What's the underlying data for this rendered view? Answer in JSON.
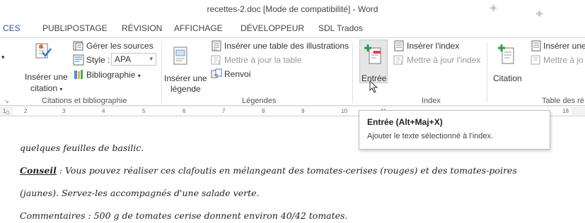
{
  "window": {
    "title": "recettes-2.doc [Mode de compatibilité] - Word"
  },
  "tabs": [
    {
      "label": "CES",
      "active": true
    },
    {
      "label": "PUBLIPOSTAGE"
    },
    {
      "label": "RÉVISION"
    },
    {
      "label": "AFFICHAGE"
    },
    {
      "label": "DÉVELOPPEUR"
    },
    {
      "label": "SDL Trados"
    }
  ],
  "groups": {
    "citations": {
      "label": "Citations et bibliographie",
      "insert_citation_1": "Insérer une",
      "insert_citation_2": "citation",
      "manage_sources": "Gérer les sources",
      "style_label": "Style :",
      "style_value": "APA",
      "bibliography": "Bibliographie"
    },
    "legends": {
      "label": "Légendes",
      "insert_caption_1": "Insérer une",
      "insert_caption_2": "légende",
      "insert_table_figures": "Insérer une table des illustrations",
      "update_table": "Mettre à jour la table",
      "cross_ref": "Renvoi"
    },
    "index": {
      "label": "Index",
      "mark_entry": "Entrée",
      "insert_index": "Insérer l'index",
      "update_index": "Mettre à jour l'index"
    },
    "toa": {
      "label": "Table des ré",
      "mark_citation": "Citation",
      "insert_table": "Insérer une",
      "update": "Mettre à jo"
    }
  },
  "ruler": {
    "ticks": [
      "1",
      "2",
      "3",
      "4",
      "5",
      "6",
      "7",
      "8",
      "9",
      "10",
      "11",
      "18"
    ]
  },
  "tooltip": {
    "title": "Entrée (Alt+Maj+X)",
    "description": "Ajouter le texte sélectionné à l'index."
  },
  "document": {
    "line1": "quelques feuilles de basilic.",
    "conseil_word": "Conseil",
    "line2_rest": " : Vous pouvez réaliser ces clafoutis en mélangeant des tomates-cerises (rouges) et des tomates-poires",
    "line3": "(jaunes). Servez-les accompagnés d'une salade verte.",
    "line4": "Commentaires : 500 g de tomates cerise donnent environ 40/42 tomates."
  },
  "colors": {
    "accent": "#2b579a",
    "highlight": "#e5e5e5"
  }
}
